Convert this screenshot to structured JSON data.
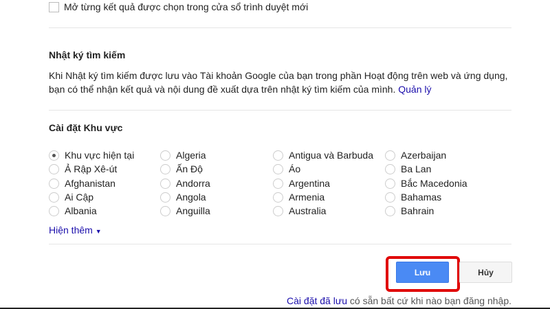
{
  "new_window": {
    "label": "Mở từng kết quả được chọn trong cửa sổ trình duyệt mới",
    "checked": false
  },
  "history": {
    "title": "Nhật ký tìm kiếm",
    "text1": "Khi Nhật ký tìm kiếm được lưu vào Tài khoản Google của bạn trong phần Hoạt động trên web và ứng dụng,",
    "text2": "bạn có thể nhận kết quả và nội dung đề xuất dựa trên nhật ký tìm kiếm của mình.",
    "manage": "Quản lý"
  },
  "region": {
    "title": "Cài đặt Khu vực",
    "columns": [
      [
        "Khu vực hiện tại",
        "Ả Rập Xê-út",
        "Afghanistan",
        "Ai Cập",
        "Albania"
      ],
      [
        "Algeria",
        "Ấn Độ",
        "Andorra",
        "Angola",
        "Anguilla"
      ],
      [
        "Antigua và Barbuda",
        "Áo",
        "Argentina",
        "Armenia",
        "Australia"
      ],
      [
        "Azerbaijan",
        "Ba Lan",
        "Bắc Macedonia",
        "Bahamas",
        "Bahrain"
      ]
    ],
    "selected": "Khu vực hiện tại",
    "show_more": "Hiện thêm"
  },
  "buttons": {
    "save": "Lưu",
    "cancel": "Hủy"
  },
  "footer": {
    "link": "Cài đặt đã lưu",
    "text": " có sẵn bất cứ khi nào bạn đăng nhập."
  },
  "colors": {
    "accent": "#4a8af4",
    "highlight": "#e00000",
    "link": "#1a0dab"
  }
}
